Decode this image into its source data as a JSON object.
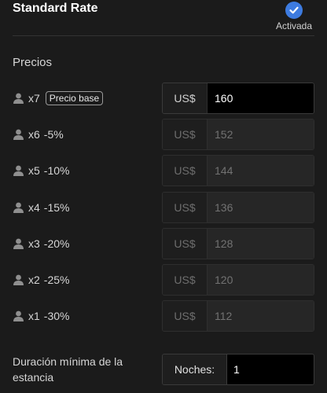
{
  "header": {
    "title": "Standard Rate",
    "status_label": "Activada",
    "status_icon": "checkmark-icon",
    "accent_color": "#3d7be0"
  },
  "prices": {
    "section_title": "Precios",
    "rows": [
      {
        "guests": "x7",
        "discount": "",
        "badge": "Precio base",
        "currency": "US$",
        "value": "160"
      },
      {
        "guests": "x6",
        "discount": "-5%",
        "badge": "",
        "currency": "US$",
        "value": "152"
      },
      {
        "guests": "x5",
        "discount": "-10%",
        "badge": "",
        "currency": "US$",
        "value": "144"
      },
      {
        "guests": "x4",
        "discount": "-15%",
        "badge": "",
        "currency": "US$",
        "value": "136"
      },
      {
        "guests": "x3",
        "discount": "-20%",
        "badge": "",
        "currency": "US$",
        "value": "128"
      },
      {
        "guests": "x2",
        "discount": "-25%",
        "badge": "",
        "currency": "US$",
        "value": "120"
      },
      {
        "guests": "x1",
        "discount": "-30%",
        "badge": "",
        "currency": "US$",
        "value": "112"
      }
    ]
  },
  "duration": {
    "label": "Duración mínima de la estancia",
    "prefix": "Noches:",
    "value": "1"
  }
}
